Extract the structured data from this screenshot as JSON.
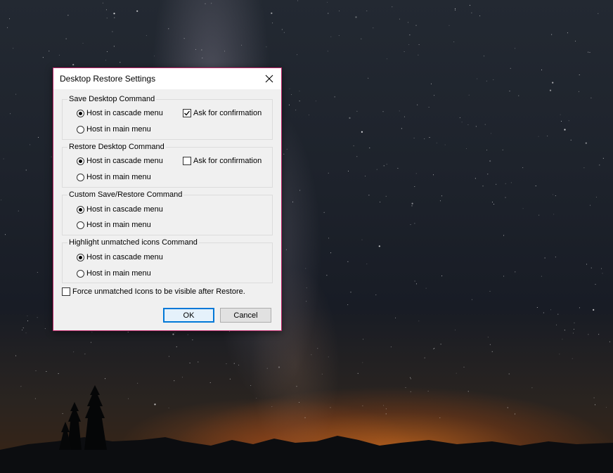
{
  "dialog": {
    "title": "Desktop Restore Settings",
    "close_icon": "close-icon",
    "groups": [
      {
        "legend": "Save Desktop Command",
        "options": [
          {
            "label": "Host in cascade menu",
            "selected": true
          },
          {
            "label": "Host in main menu",
            "selected": false
          }
        ],
        "confirm": {
          "label": "Ask for confirmation",
          "checked": true
        }
      },
      {
        "legend": "Restore Desktop Command",
        "options": [
          {
            "label": "Host in cascade menu",
            "selected": true
          },
          {
            "label": "Host in main menu",
            "selected": false
          }
        ],
        "confirm": {
          "label": "Ask for confirmation",
          "checked": false
        }
      },
      {
        "legend": "Custom Save/Restore Command",
        "options": [
          {
            "label": "Host in cascade menu",
            "selected": true
          },
          {
            "label": "Host in main menu",
            "selected": false
          }
        ]
      },
      {
        "legend": "Highlight unmatched icons Command",
        "options": [
          {
            "label": "Host in cascade menu",
            "selected": true
          },
          {
            "label": "Host in main menu",
            "selected": false
          }
        ]
      }
    ],
    "force_visible": {
      "label": "Force unmatched Icons to be visible after Restore.",
      "checked": false
    },
    "ok_label": "OK",
    "cancel_label": "Cancel"
  },
  "colors": {
    "dialog_border": "#c0266a",
    "default_button_border": "#0078d7"
  }
}
